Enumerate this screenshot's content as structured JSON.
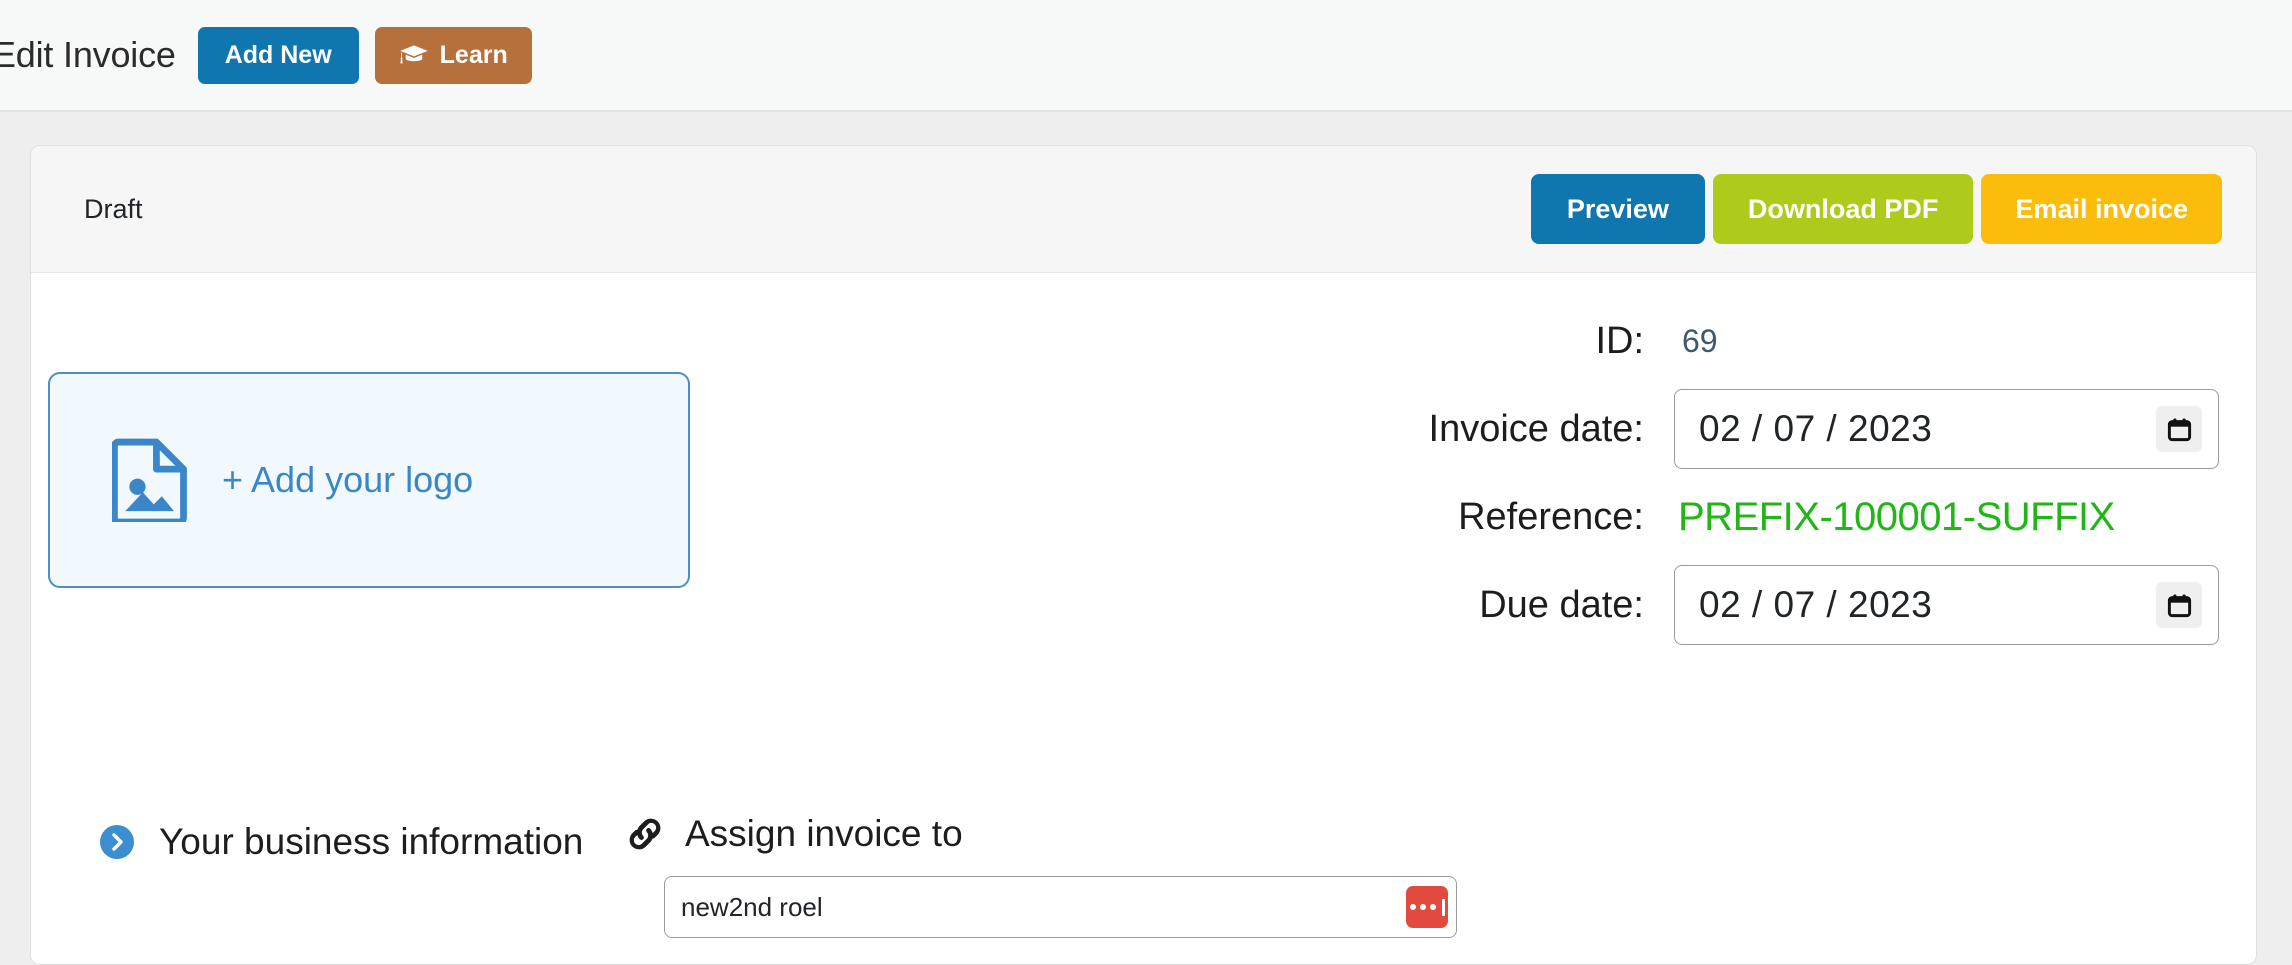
{
  "header": {
    "title": "Edit Invoice",
    "add_new_label": "Add New",
    "learn_label": "Learn",
    "learn_icon": "graduation-cap-icon"
  },
  "card": {
    "status": "Draft",
    "actions": {
      "preview_label": "Preview",
      "download_label": "Download PDF",
      "email_label": "Email invoice"
    },
    "logo": {
      "label": "+ Add your logo",
      "icon": "image-file-icon"
    },
    "meta": [
      {
        "label": "ID:",
        "value": "69",
        "type": "text"
      },
      {
        "label": "Invoice date:",
        "value": "02 / 07 / 2023",
        "type": "date"
      },
      {
        "label": "Reference:",
        "value": "PREFIX-100001-SUFFIX",
        "type": "reference"
      },
      {
        "label": "Due date:",
        "value": "02 / 07 / 2023",
        "type": "date"
      }
    ],
    "business_section": {
      "label": "Your business information",
      "icon": "circle-chevron-right-icon"
    },
    "assign_section": {
      "label": "Assign invoice to",
      "icon": "link-icon",
      "input_value": "new2nd roel",
      "input_placeholder": "",
      "password_manager_icon": "lastpass-icon"
    }
  },
  "colors": {
    "primary_blue": "#0f76b0",
    "learn_brown": "#b5703c",
    "download_green": "#aecb1c",
    "email_amber": "#fbbc0b",
    "reference_green": "#1fb616",
    "logo_blue": "#3a86c8",
    "pwmgr_red": "#e04a3f",
    "page_bg": "#eeeeee"
  }
}
